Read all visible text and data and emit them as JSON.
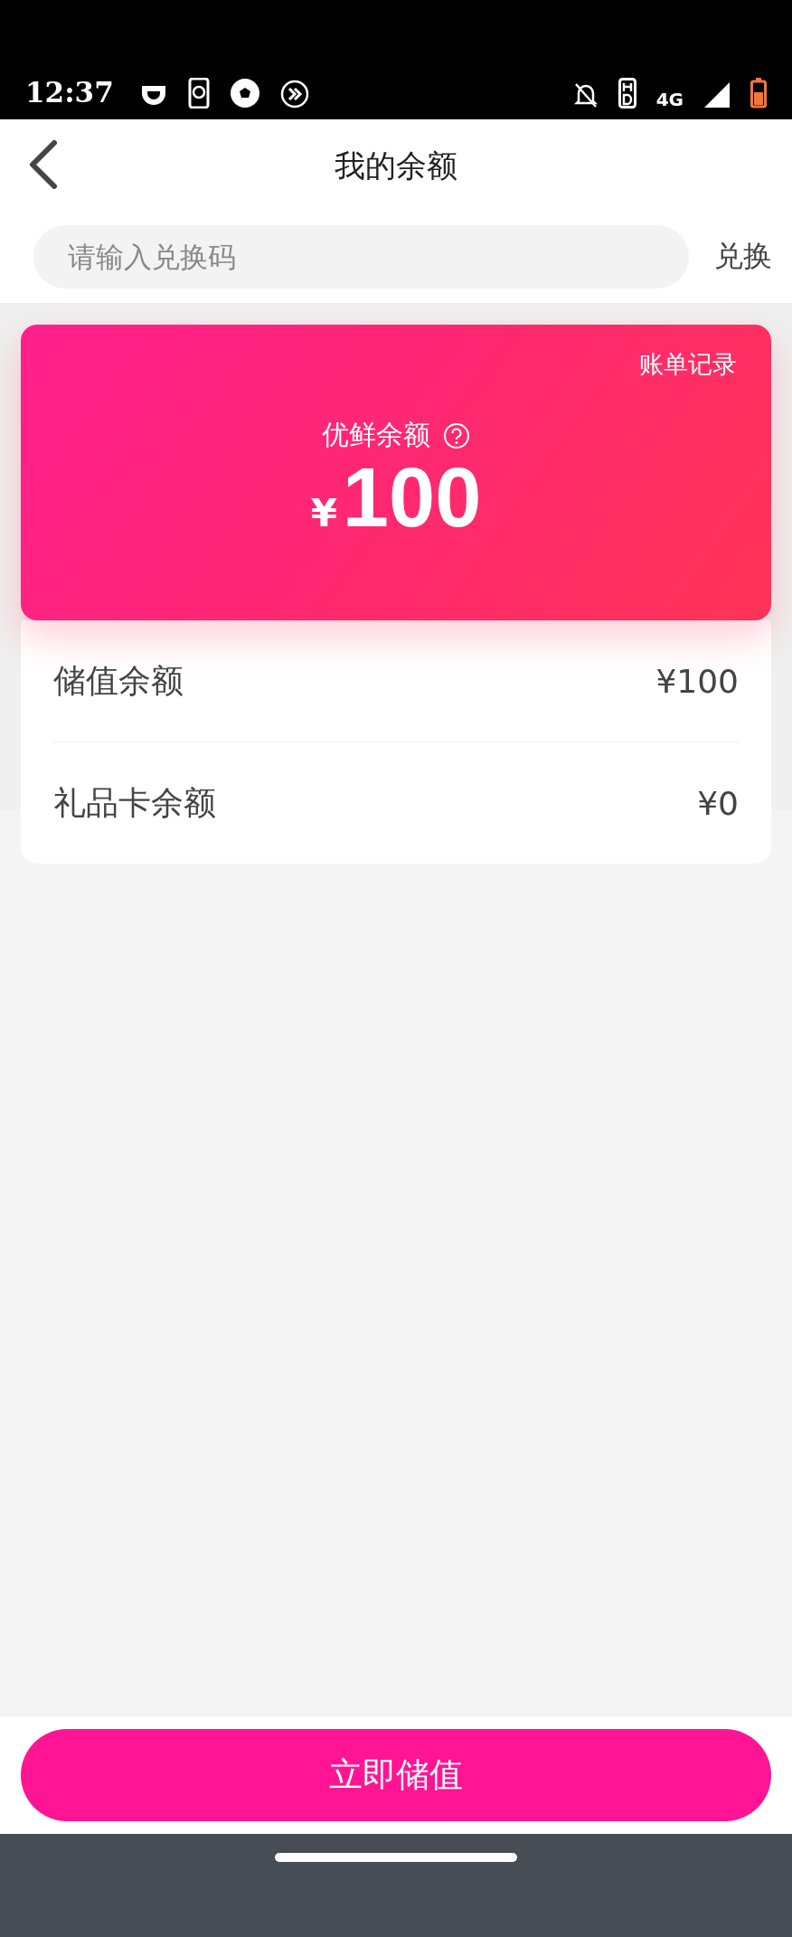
{
  "status_bar": {
    "time": "12:37",
    "network": "4G"
  },
  "header": {
    "title": "我的余额"
  },
  "redeem": {
    "placeholder": "请输入兑换码",
    "button": "兑换"
  },
  "balance_card": {
    "link": "账单记录",
    "label": "优鲜余额",
    "currency": "¥",
    "amount": "100"
  },
  "balances": [
    {
      "label": "储值余额",
      "value": "¥100"
    },
    {
      "label": "礼品卡余额",
      "value": "¥0"
    }
  ],
  "action_button": "立即储值"
}
